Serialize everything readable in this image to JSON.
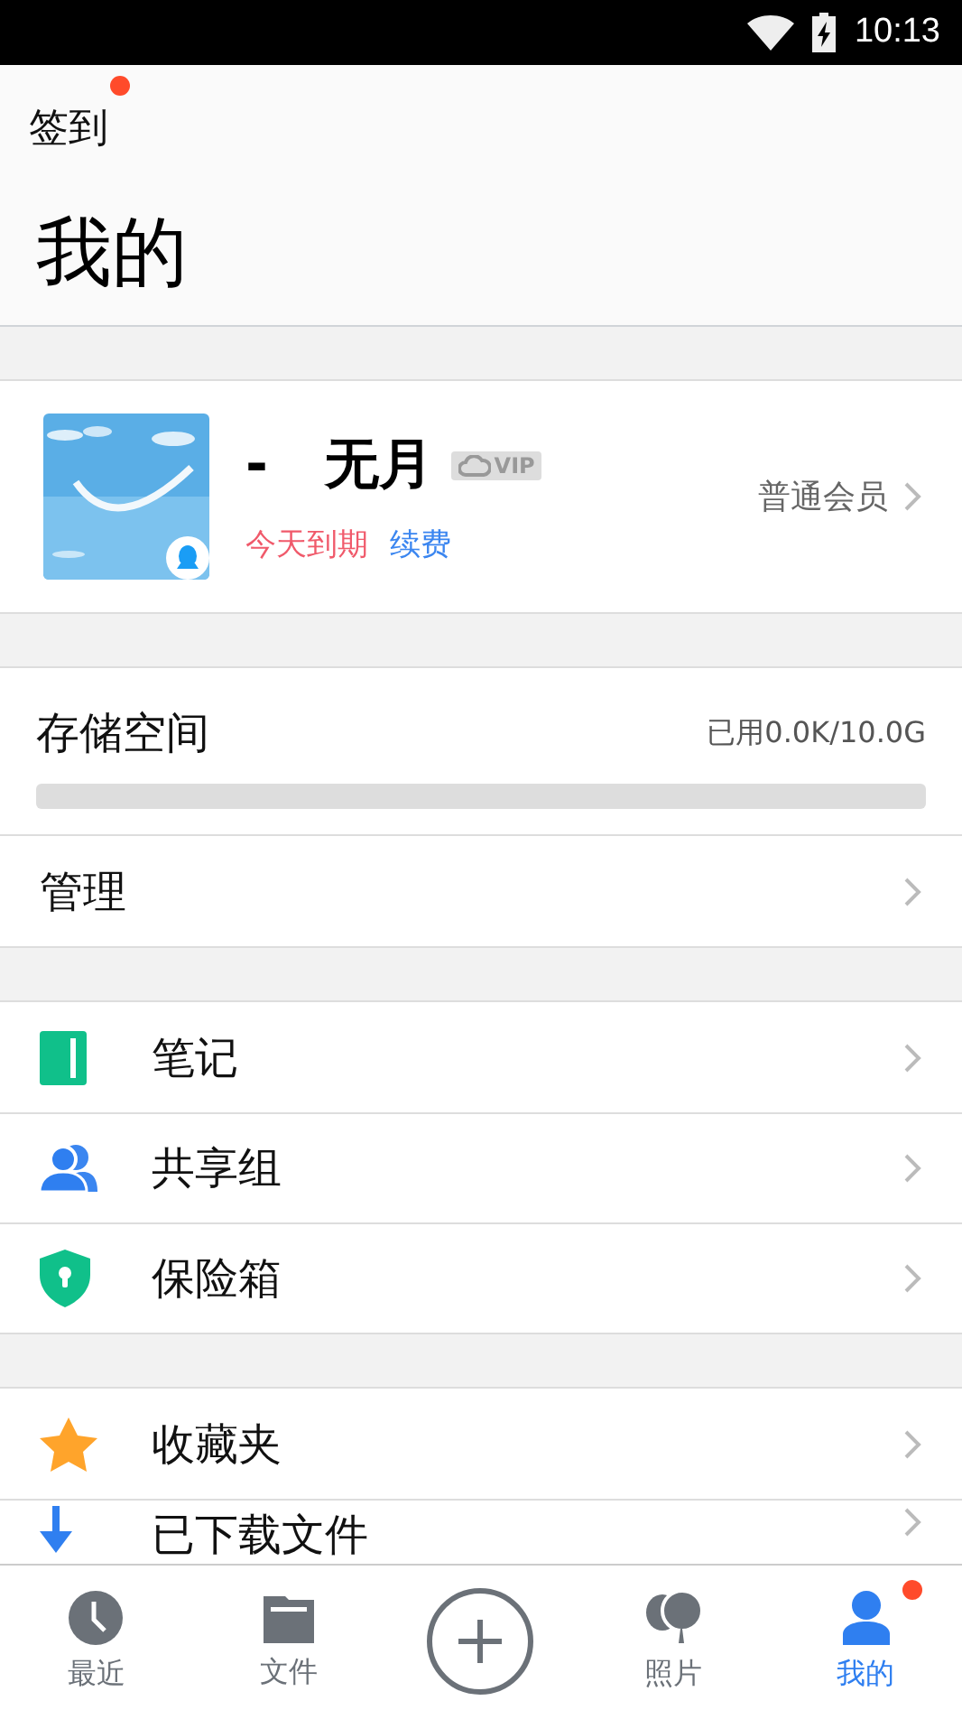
{
  "status_bar": {
    "time": "10:13"
  },
  "header": {
    "sign_in": {
      "label": "签到",
      "badge": true
    },
    "title": "我的"
  },
  "profile": {
    "name": "-   无月",
    "vip_badge": "VIP",
    "expiry": "今天到期",
    "renew": "续费",
    "membership": "普通会员"
  },
  "storage": {
    "label": "存储空间",
    "usage": "已用0.0K/10.0G",
    "level": 0
  },
  "manage": {
    "label": "管理"
  },
  "groups": [
    [
      {
        "kind": "notes",
        "label": "笔记"
      },
      {
        "kind": "share",
        "label": "共享组"
      },
      {
        "kind": "safe",
        "label": "保险箱"
      }
    ],
    [
      {
        "kind": "favorites",
        "label": "收藏夹"
      },
      {
        "kind": "downloads",
        "label": "已下载文件"
      }
    ]
  ],
  "tabs": [
    {
      "kind": "recent",
      "label": "最近",
      "selected": false,
      "badge": false
    },
    {
      "kind": "files",
      "label": "文件",
      "selected": false,
      "badge": false
    },
    {
      "kind": "add",
      "selected": false,
      "badge": false
    },
    {
      "kind": "photos",
      "label": "照片",
      "selected": false,
      "badge": false
    },
    {
      "kind": "me",
      "label": "我的",
      "selected": true,
      "badge": true
    }
  ]
}
